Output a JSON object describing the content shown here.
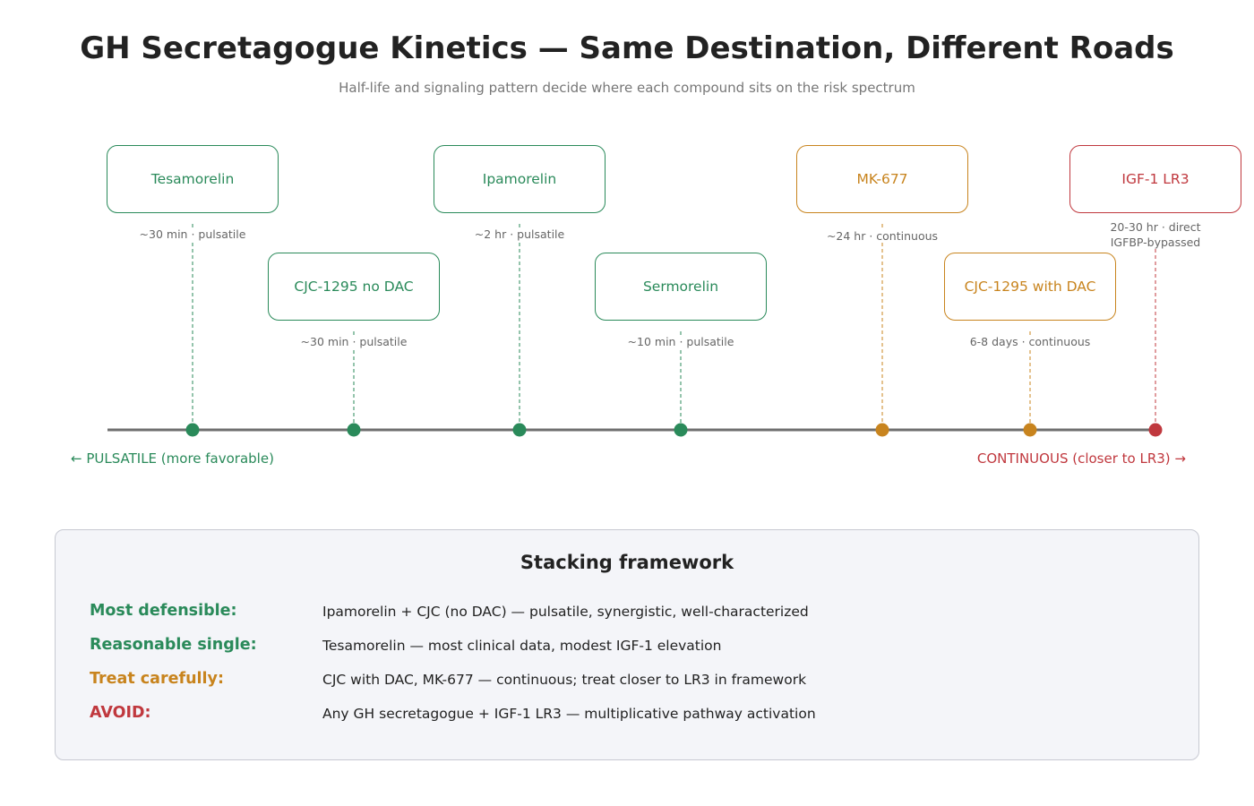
{
  "header": {
    "title": "GH Secretagogue Kinetics — Same Destination, Different Roads",
    "subtitle": "Half-life and signaling pattern decide where each compound sits on the risk spectrum"
  },
  "colors": {
    "green": "#2a8a5a",
    "orange": "#c8841e",
    "red": "#c0383e",
    "axis": "#6f6f6f"
  },
  "spectrum": {
    "left_label": "← PULSATILE (more favorable)",
    "right_label": "CONTINUOUS (closer to LR3) →",
    "compounds": [
      {
        "name": "Tesamorelin",
        "kinetics": "~30 min · pulsatile",
        "category": "green"
      },
      {
        "name": "CJC-1295 no DAC",
        "kinetics": "~30 min · pulsatile",
        "category": "green"
      },
      {
        "name": "Ipamorelin",
        "kinetics": "~2 hr · pulsatile",
        "category": "green"
      },
      {
        "name": "Sermorelin",
        "kinetics": "~10 min · pulsatile",
        "category": "green"
      },
      {
        "name": "MK-677",
        "kinetics": "~24 hr · continuous",
        "category": "orange"
      },
      {
        "name": "CJC-1295 with DAC",
        "kinetics": "6-8 days · continuous",
        "category": "orange"
      },
      {
        "name": "IGF-1 LR3",
        "kinetics": "20-30 hr · direct\nIGFBP-bypassed",
        "category": "red"
      }
    ]
  },
  "framework": {
    "title": "Stacking framework",
    "rows": [
      {
        "label": "Most defensible:",
        "text": "Ipamorelin + CJC (no DAC) — pulsatile, synergistic, well-characterized",
        "category": "green"
      },
      {
        "label": "Reasonable single:",
        "text": "Tesamorelin — most clinical data, modest IGF-1 elevation",
        "category": "green"
      },
      {
        "label": "Treat carefully:",
        "text": "CJC with DAC, MK-677 — continuous; treat closer to LR3 in framework",
        "category": "orange"
      },
      {
        "label": "AVOID:",
        "text": "Any GH secretagogue + IGF-1 LR3 — multiplicative pathway activation",
        "category": "red"
      }
    ]
  }
}
